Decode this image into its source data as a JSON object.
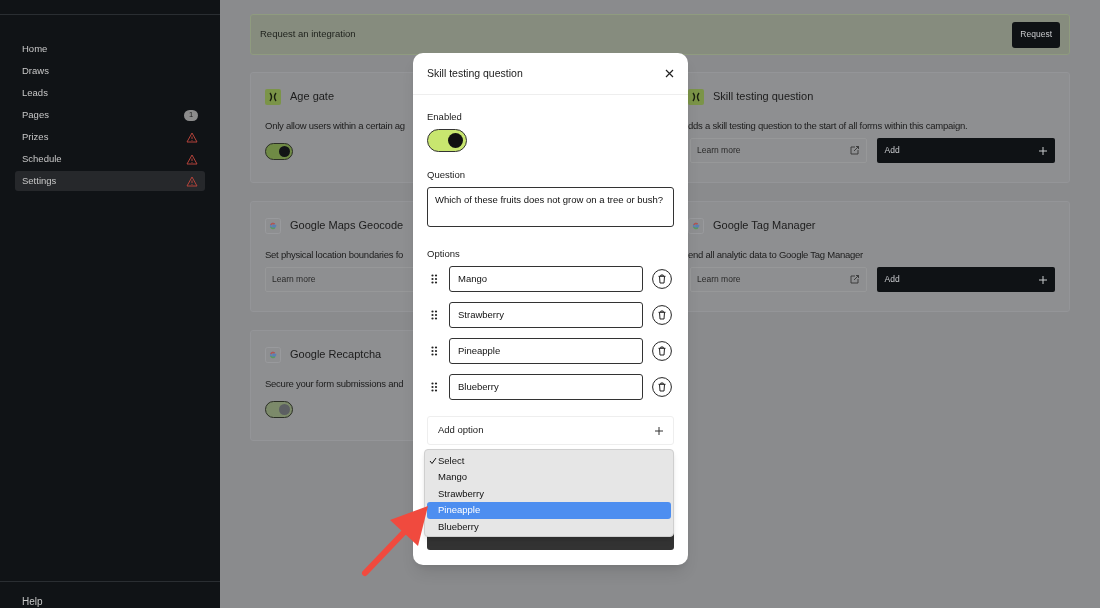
{
  "sidebar": {
    "items": [
      {
        "label": "Home",
        "selected": false,
        "warning": false
      },
      {
        "label": "Draws",
        "selected": false,
        "warning": false
      },
      {
        "label": "Leads",
        "selected": false,
        "warning": false
      },
      {
        "label": "Pages",
        "selected": false,
        "warning": false,
        "badge": "1"
      },
      {
        "label": "Prizes",
        "selected": false,
        "warning": true
      },
      {
        "label": "Schedule",
        "selected": false,
        "warning": true
      },
      {
        "label": "Settings",
        "selected": true,
        "warning": true
      }
    ],
    "footer": "Help"
  },
  "integration_request": {
    "text": "Request an integration",
    "button": "Request"
  },
  "integrations": [
    {
      "title": "Age gate",
      "description": "Only allow users within a certain ag",
      "kind": "code-toggle",
      "on": true,
      "disabled": false
    },
    {
      "title": "Skill testing question",
      "description": "dds a skill testing question to the start of all forms within this campaign.",
      "kind": "code-actions",
      "learn_more": "Learn more",
      "external_link": true,
      "add": "Add"
    },
    {
      "title": "Google Maps Geocode",
      "description": "Set physical location boundaries fo",
      "kind": "google-actions",
      "learn_more": "Learn more"
    },
    {
      "title": "Google Tag Manager",
      "description": "end all analytic data to Google Tag Manager",
      "kind": "google-actions",
      "learn_more": "Learn more",
      "external_link": true,
      "add": "Add"
    },
    {
      "title": "Google Recaptcha",
      "description": "Secure your form submissions and",
      "kind": "google-toggle",
      "on": true,
      "disabled": true
    }
  ],
  "modal": {
    "title": "Skill testing question",
    "enabled_label": "Enabled",
    "enabled": true,
    "question_label": "Question",
    "question": "Which of these fruits does not grow on a tree or bush?",
    "options_label": "Options",
    "options": [
      "Mango",
      "Strawberry",
      "Pineapple",
      "Blueberry"
    ],
    "add_option": "Add option",
    "dropdown": [
      {
        "label": "Select",
        "checked": true,
        "highlighted": false
      },
      {
        "label": "Mango",
        "checked": false,
        "highlighted": false
      },
      {
        "label": "Strawberry",
        "checked": false,
        "highlighted": false
      },
      {
        "label": "Pineapple",
        "checked": false,
        "highlighted": true
      },
      {
        "label": "Blueberry",
        "checked": false,
        "highlighted": false
      }
    ]
  }
}
